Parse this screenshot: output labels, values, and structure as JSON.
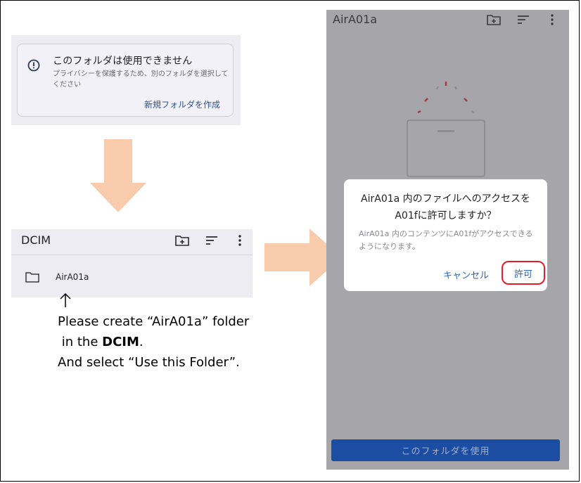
{
  "warning": {
    "title": "このフォルダは使用できません",
    "description": "プライバシーを保護するため、別のフォルダを選択してください",
    "create_link": "新規フォルダを作成",
    "icon": "info-icon"
  },
  "dcim_panel": {
    "title": "DCIM",
    "folder_name": "AirA01a",
    "icons": [
      "new-folder-icon",
      "sort-icon",
      "more-vert-icon",
      "folder-icon"
    ]
  },
  "instruction": {
    "line1": "Please create “AirA01a” folder",
    "line2_prefix": " in the ",
    "line2_bold": "DCIM",
    "line2_suffix": ".",
    "line3": "And select “Use this Folder”."
  },
  "phone": {
    "title": "AirA01a",
    "dialog_title": "AirA01a 内のファイルへのアクセスをA01fに許可しますか？",
    "dialog_body": "AirA01a 内のコンテンツにA01fがアクセスできるようになります。",
    "cancel_label": "キャンセル",
    "allow_label": "許可",
    "use_folder_label": "このフォルダを使用"
  },
  "colors": {
    "panel_bg": "#eeecf3",
    "arrow": "#f8cbad",
    "link_blue": "#2b66b8",
    "highlight_red": "#e01f26",
    "primary_button": "#1b4da3"
  }
}
